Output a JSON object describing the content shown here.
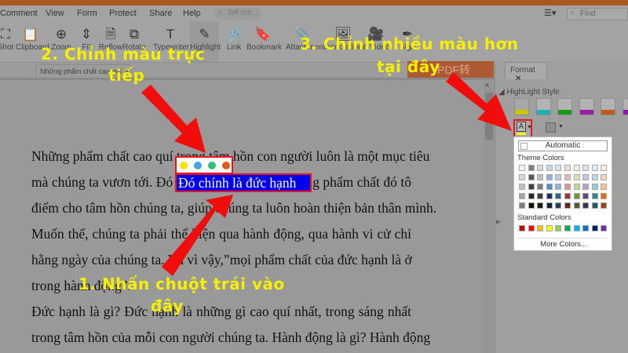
{
  "menu": [
    "Comment",
    "View",
    "Form",
    "Protect",
    "Share",
    "Help"
  ],
  "tell_placeholder": "Tell me...",
  "find_placeholder": "Find",
  "ribbon": [
    {
      "label": "Shot",
      "icon": "screenshot-icon",
      "g": "⛶"
    },
    {
      "label": "Clipboard",
      "icon": "clipboard-icon",
      "g": "📋"
    },
    {
      "label": "Zoom",
      "icon": "zoom-icon",
      "g": "⊕"
    },
    {
      "label": "Fit",
      "icon": "fit-page-icon",
      "g": "⇕"
    },
    {
      "label": "Reflow",
      "icon": "reflow-icon",
      "g": "🗎"
    },
    {
      "label": "Rotate",
      "icon": "rotate-icon",
      "g": "⧉"
    },
    {
      "label": "Typewriter",
      "icon": "typewriter-icon",
      "g": "T"
    },
    {
      "label": "Highlight",
      "icon": "highlight-icon",
      "g": "✎"
    },
    {
      "label": "Link",
      "icon": "link-icon",
      "g": "🔗"
    },
    {
      "label": "Bookmark",
      "icon": "bookmark-icon",
      "g": "🔖"
    },
    {
      "label": "Attachment",
      "icon": "attachment-icon",
      "g": "📎"
    },
    {
      "label": "Annotation",
      "icon": "image-annotation-icon",
      "g": "🖼"
    },
    {
      "label": "& Video",
      "icon": "video-icon",
      "g": "🎥"
    },
    {
      "label": "Sign",
      "icon": "sign-icon",
      "g": "✒"
    }
  ],
  "doc_tab": "Những phẩm chất cao quí",
  "pdf2word": "PDF转Word",
  "panel": {
    "tab": "Format",
    "section": "HighLight Style",
    "swatches": [
      "#c8c800",
      "#1fb0b0",
      "#1a9a1a",
      "#a01aa8",
      "#c05a1a",
      "#8a1aa8"
    ]
  },
  "popup": {
    "automatic": "Automatic",
    "theme_label": "Theme Colors",
    "standard_label": "Standard Colors",
    "more": "More Colors...",
    "theme": [
      [
        "#f2f2f2",
        "#7f7f7f",
        "#d8d8d8",
        "#c6d9f0",
        "#dbe5f1",
        "#f2dcdb",
        "#ebf1dd",
        "#e5e0ec",
        "#dbeef3",
        "#fdeada"
      ],
      [
        "#d8d8d8",
        "#595959",
        "#bfbfbf",
        "#8db3e2",
        "#b8cce4",
        "#e5b9b7",
        "#d7e3bc",
        "#ccc1d9",
        "#b7dde8",
        "#fbd5b5"
      ],
      [
        "#bfbfbf",
        "#3f3f3f",
        "#7f7f7f",
        "#548dd4",
        "#95b3d7",
        "#d99694",
        "#c3d69b",
        "#b2a2c7",
        "#92cddc",
        "#fac08f"
      ],
      [
        "#a5a5a5",
        "#262626",
        "#3f3f3f",
        "#17365d",
        "#366092",
        "#953734",
        "#76923c",
        "#5f497a",
        "#31859b",
        "#e36c09"
      ],
      [
        "#7f7f7f",
        "#0c0c0c",
        "#1d1b10",
        "#0f243e",
        "#244061",
        "#632423",
        "#4f6128",
        "#3f3151",
        "#205867",
        "#974806"
      ]
    ],
    "standard": [
      "#c00000",
      "#ff0000",
      "#ffc000",
      "#ffff00",
      "#92d050",
      "#00b050",
      "#00b0f0",
      "#0070c0",
      "#002060",
      "#7030a0"
    ]
  },
  "doc": {
    "lines": [
      "Những phẩm chất cao quí trong tâm hồn con người luôn là một mục tiêu",
      "mà chúng ta vươn tới. Đó chính là đức hạnh. Những phẩm chất đó tô",
      "điểm cho tâm hồn chúng ta, giúp chúng ta luôn hoàn thiện bản thân mình.",
      "Muốn thế, chúng ta phải thể hiện qua hành động, qua hành vi cử chỉ",
      "hằng ngày của chúng ta. Và vì vậy,”mọi phẩm chất của đức hạnh là ở",
      "trong hành động”.",
      "Đức hạnh là gì? Đức hạnh là những gì cao quí nhất, trong sáng nhất",
      "trong tâm hồn của mỗi con người chúng ta. Hành động là gì? Hành động"
    ],
    "selected": "Đó chính là đức hạnh",
    "quick_colors": [
      "#f5e400",
      "#4aa3e8",
      "#2ec27e",
      "#e05a1a"
    ]
  },
  "annotations": {
    "step1a": "1. Nhấn chuột trái vào",
    "step1b": "đây",
    "step2a": "2. Chỉnh màu trực",
    "step2b": "tiếp",
    "step3a": "3. Chỉnh nhiều màu hơn",
    "step3b": "tại đây"
  }
}
